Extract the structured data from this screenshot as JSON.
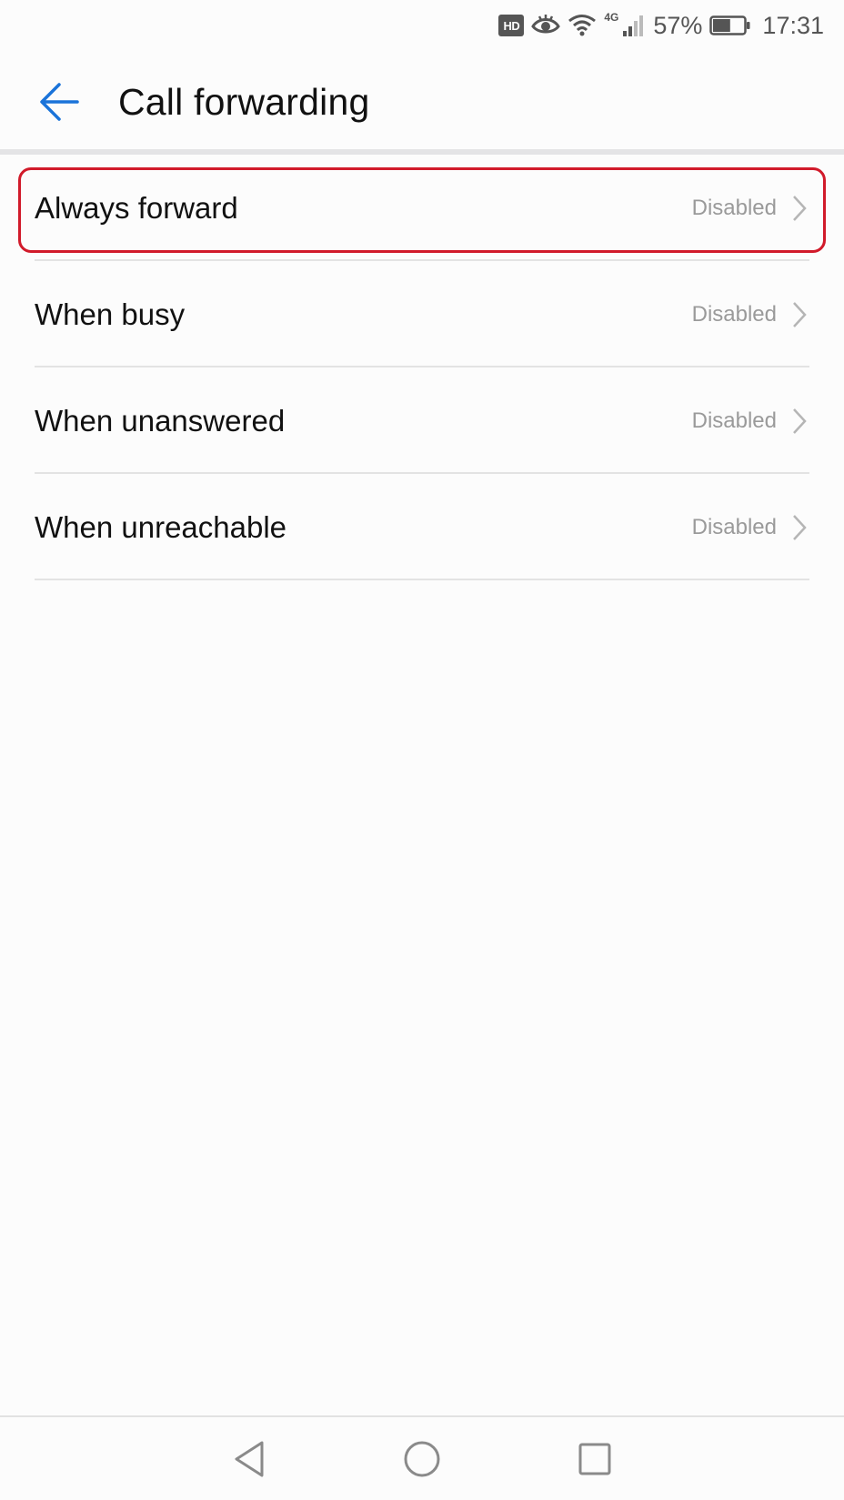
{
  "status_bar": {
    "hd_label": "HD",
    "network_label": "4G",
    "battery_percent": "57%",
    "battery_level": 0.57,
    "time": "17:31",
    "icons": [
      "hd-icon",
      "eye-icon",
      "wifi-icon",
      "signal-icon",
      "battery-icon"
    ]
  },
  "header": {
    "title": "Call forwarding",
    "back_icon": "arrow-left-icon",
    "accent_color": "#1a73d9"
  },
  "items": [
    {
      "label": "Always forward",
      "value": "Disabled"
    },
    {
      "label": "When busy",
      "value": "Disabled"
    },
    {
      "label": "When unanswered",
      "value": "Disabled"
    },
    {
      "label": "When unreachable",
      "value": "Disabled"
    }
  ],
  "highlight": {
    "item_index": 0,
    "color": "#d11a2a"
  },
  "nav_bar": {
    "buttons": [
      "back-triangle-icon",
      "home-circle-icon",
      "recents-square-icon"
    ]
  }
}
